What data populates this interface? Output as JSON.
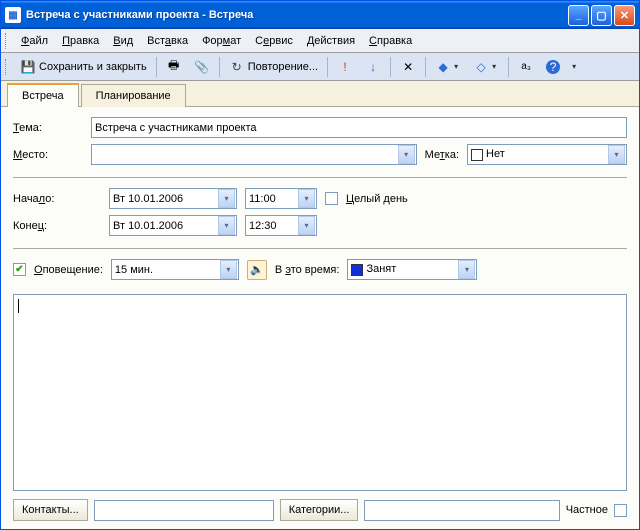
{
  "titlebar": {
    "title": "Встреча с участниками проекта - Встреча"
  },
  "menu": {
    "file": "Файл",
    "edit": "Правка",
    "view": "Вид",
    "insert": "Вставка",
    "format": "Формат",
    "service": "Сервис",
    "actions": "Действия",
    "help": "Справка"
  },
  "toolbar": {
    "save_close": "Сохранить и закрыть",
    "recurrence": "Повторение..."
  },
  "tabs": {
    "meeting": "Встреча",
    "planning": "Планирование"
  },
  "form": {
    "subject_label": "Тема:",
    "subject_value": "Встреча с участниками проекта",
    "location_label": "Место:",
    "location_value": "",
    "marker_label": "Метка:",
    "marker_value": "Нет",
    "start_label": "Начало:",
    "start_date": "Вт 10.01.2006",
    "start_time": "11:00",
    "end_label": "Конец:",
    "end_date": "Вт 10.01.2006",
    "end_time": "12:30",
    "allday_label": "Целый день",
    "reminder_label": "Оповещение:",
    "reminder_value": "15 мин.",
    "busy_label": "В это время:",
    "busy_value": "Занят"
  },
  "footer": {
    "contacts": "Контакты...",
    "categories": "Категории...",
    "private": "Частное"
  }
}
